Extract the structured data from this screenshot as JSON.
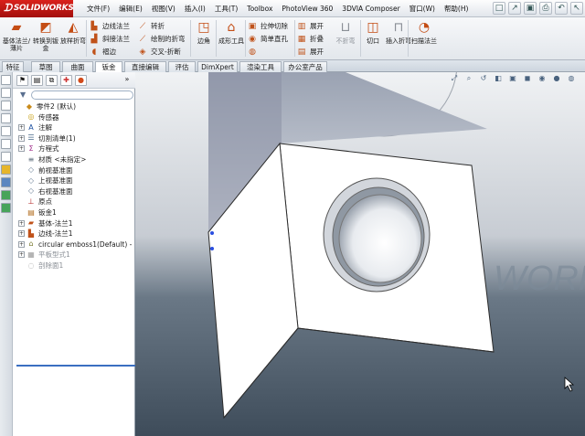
{
  "app": {
    "logo": "SOLIDWORKS"
  },
  "menu": [
    "文件(F)",
    "编辑(E)",
    "视图(V)",
    "插入(I)",
    "工具(T)",
    "Toolbox",
    "PhotoView 360",
    "3DVIA Composer",
    "窗口(W)",
    "帮助(H)"
  ],
  "ribbon": {
    "big_buttons": [
      {
        "label": "基体法兰/薄片",
        "icon": "base-flange-icon"
      },
      {
        "label": "转换到钣金",
        "icon": "convert-sheetmetal-icon"
      },
      {
        "label": "放样折弯",
        "icon": "lofted-bend-icon"
      }
    ],
    "small_group1": [
      "边线法兰",
      "斜接法兰",
      "褶边"
    ],
    "small_group2": [
      "转折",
      "绘制的折弯",
      "交叉-折断"
    ],
    "edge_button": "边角",
    "form_tool": "成形工具",
    "small_group3": [
      "拉伸切除",
      "简单直孔"
    ],
    "small_group4": [
      "展开",
      "折叠",
      "展开"
    ],
    "no_bends": "不折弯",
    "rip": "切口",
    "insert_bends": "插入折弯",
    "sweep_flange": "扫描法兰"
  },
  "tabs": [
    "特征",
    "草图",
    "曲面",
    "钣金",
    "直接编辑",
    "评估",
    "DimXpert",
    "渲染工具",
    "办公室产品"
  ],
  "active_tab": "钣金",
  "tree": [
    {
      "label": "零件2 (默认)",
      "icon": "part-icon",
      "expand": false,
      "indent": 0
    },
    {
      "label": "传感器",
      "icon": "sensor-icon",
      "expand": false,
      "indent": 1
    },
    {
      "label": "注解",
      "icon": "annotation-icon",
      "expand": true,
      "indent": 1
    },
    {
      "label": "切割清单(1)",
      "icon": "cut-list-icon",
      "expand": true,
      "indent": 1
    },
    {
      "label": "方程式",
      "icon": "equation-icon",
      "expand": true,
      "indent": 1
    },
    {
      "label": "材质 <未指定>",
      "icon": "material-icon",
      "expand": false,
      "indent": 1
    },
    {
      "label": "前视基准面",
      "icon": "plane-icon",
      "expand": false,
      "indent": 1
    },
    {
      "label": "上视基准面",
      "icon": "plane-icon",
      "expand": false,
      "indent": 1
    },
    {
      "label": "右视基准面",
      "icon": "plane-icon",
      "expand": false,
      "indent": 1
    },
    {
      "label": "原点",
      "icon": "origin-icon",
      "expand": false,
      "indent": 1
    },
    {
      "label": "钣金1",
      "icon": "sheetmetal-icon",
      "expand": false,
      "indent": 1
    },
    {
      "label": "基体-法兰1",
      "icon": "base-flange-icon",
      "expand": true,
      "indent": 1
    },
    {
      "label": "边线-法兰1",
      "icon": "edge-flange-icon",
      "expand": true,
      "indent": 1
    },
    {
      "label": "circular emboss1(Default) -",
      "icon": "form-tool-icon",
      "expand": true,
      "indent": 1
    },
    {
      "label": "平板型式1",
      "icon": "flat-pattern-icon",
      "expand": true,
      "indent": 1,
      "gray": true
    },
    {
      "label": "剖除面1",
      "icon": "cut-face-icon",
      "expand": false,
      "indent": 1,
      "gray": true
    }
  ],
  "viewport": {
    "watermark": "WORK"
  }
}
